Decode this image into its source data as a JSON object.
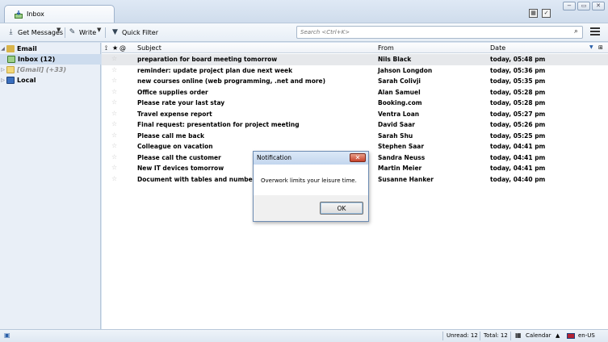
{
  "tab": {
    "label": "Inbox",
    "icon": "inbox-icon"
  },
  "toolbar": {
    "get_messages": "Get Messages",
    "write": "Write",
    "quick_filter": "Quick Filter",
    "search_placeholder": "Search <Ctrl+K>"
  },
  "folders": [
    {
      "label": "Email",
      "icon": "email-account-icon",
      "bold": true
    },
    {
      "label": "Inbox (12)",
      "icon": "inbox-icon",
      "bold": true,
      "selected": true
    },
    {
      "label": "[Gmail] (+33)",
      "icon": "folder-icon",
      "bold": true
    },
    {
      "label": "Local",
      "icon": "local-folders-icon",
      "bold": true
    }
  ],
  "columns": {
    "subject": "Subject",
    "from": "From",
    "date": "Date"
  },
  "messages": [
    {
      "subject": "preparation for board meeting tomorrow",
      "from": "Nils Black",
      "date": "today, 05:48 pm"
    },
    {
      "subject": "reminder: update project plan due next week",
      "from": "Jahson Longdon",
      "date": "today, 05:36 pm"
    },
    {
      "subject": "new courses online (web programming, .net and more)",
      "from": "Sarah Colivji",
      "date": "today, 05:35 pm"
    },
    {
      "subject": "Office supplies order",
      "from": "Alan Samuel",
      "date": "today, 05:28 pm"
    },
    {
      "subject": "Please rate your last stay",
      "from": "Booking.com",
      "date": "today, 05:28 pm"
    },
    {
      "subject": "Travel expense report",
      "from": "Ventra Loan",
      "date": "today, 05:27 pm"
    },
    {
      "subject": "Final request: presentation for project meeting",
      "from": "David Saar",
      "date": "today, 05:26 pm"
    },
    {
      "subject": "Please call me back",
      "from": "Sarah Shu",
      "date": "today, 05:25 pm"
    },
    {
      "subject": "Colleague on vacation",
      "from": "Stephen Saar",
      "date": "today, 04:41 pm"
    },
    {
      "subject": "Please call the customer",
      "from": "Sandra Neuss",
      "date": "today, 04:41 pm"
    },
    {
      "subject": "New IT devices tomorrow",
      "from": "Martin Meier",
      "date": "today, 04:41 pm"
    },
    {
      "subject": "Document with tables and numbers",
      "from": "Susanne Hanker",
      "date": "today, 04:40 pm"
    }
  ],
  "status": {
    "unread": "Unread: 12",
    "total": "Total: 12",
    "calendar": "Calendar",
    "language": "en-US"
  },
  "dialog": {
    "title": "Notification",
    "message": "Overwork limits your leisure time.",
    "ok": "OK"
  },
  "colors": {
    "accent": "#2a5fa8",
    "selection": "#cddcee",
    "close_button": "#c7412a"
  }
}
